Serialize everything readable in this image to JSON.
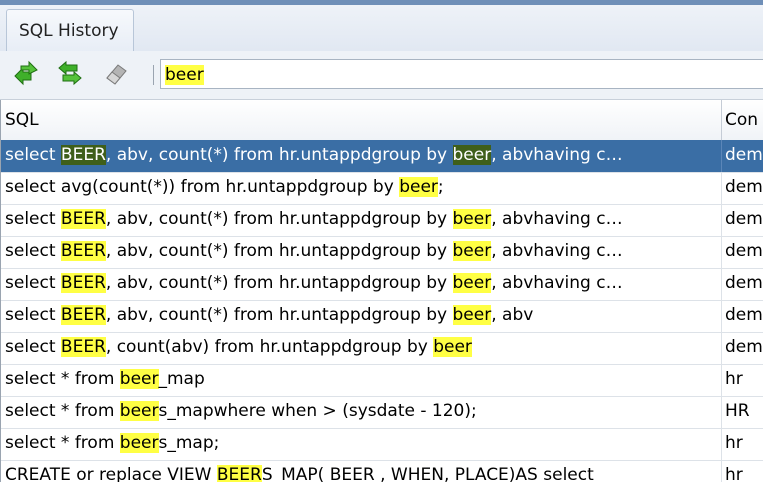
{
  "panel": {
    "title": "SQL History"
  },
  "colors": {
    "highlight": "#ffff44",
    "selected_row": "#3a6ea5",
    "selected_match": "#3f5f1a"
  },
  "toolbar": {
    "buttons": [
      {
        "icon": "append-green-arrows-icon"
      },
      {
        "icon": "replace-green-arrows-icon"
      },
      {
        "icon": "eraser-icon"
      }
    ],
    "filter_value": "beer"
  },
  "table": {
    "headers": {
      "sql": "SQL",
      "connection": "Con"
    },
    "rows": [
      {
        "selected": true,
        "conn": "dem",
        "parts": [
          [
            "select ",
            false
          ],
          [
            "BEER",
            true
          ],
          [
            ", abv, count(*) from hr.untappdgroup by ",
            false
          ],
          [
            "beer",
            true
          ],
          [
            ", abvhaving c…",
            false
          ]
        ]
      },
      {
        "selected": false,
        "conn": "dem",
        "parts": [
          [
            "select avg(count(*)) from hr.untappdgroup by ",
            false
          ],
          [
            "beer",
            true
          ],
          [
            ";",
            false
          ]
        ]
      },
      {
        "selected": false,
        "conn": "dem",
        "parts": [
          [
            "select ",
            false
          ],
          [
            "BEER",
            true
          ],
          [
            ", abv, count(*) from hr.untappdgroup by ",
            false
          ],
          [
            "beer",
            true
          ],
          [
            ", abvhaving c…",
            false
          ]
        ]
      },
      {
        "selected": false,
        "conn": "dem",
        "parts": [
          [
            "select ",
            false
          ],
          [
            "BEER",
            true
          ],
          [
            ", abv, count(*) from hr.untappdgroup by ",
            false
          ],
          [
            "beer",
            true
          ],
          [
            ", abvhaving c…",
            false
          ]
        ]
      },
      {
        "selected": false,
        "conn": "dem",
        "parts": [
          [
            "select ",
            false
          ],
          [
            "BEER",
            true
          ],
          [
            ", abv, count(*) from hr.untappdgroup by ",
            false
          ],
          [
            "beer",
            true
          ],
          [
            ", abvhaving c…",
            false
          ]
        ]
      },
      {
        "selected": false,
        "conn": "dem",
        "parts": [
          [
            "select ",
            false
          ],
          [
            "BEER",
            true
          ],
          [
            ", abv, count(*) from hr.untappdgroup by ",
            false
          ],
          [
            "beer",
            true
          ],
          [
            ", abv",
            false
          ]
        ]
      },
      {
        "selected": false,
        "conn": "dem",
        "parts": [
          [
            "select ",
            false
          ],
          [
            "BEER",
            true
          ],
          [
            ", count(abv) from hr.untappdgroup by ",
            false
          ],
          [
            "beer",
            true
          ]
        ]
      },
      {
        "selected": false,
        "conn": "hr",
        "parts": [
          [
            "select * from ",
            false
          ],
          [
            "beer",
            true
          ],
          [
            "_map",
            false
          ]
        ]
      },
      {
        "selected": false,
        "conn": "HR",
        "parts": [
          [
            "select * from ",
            false
          ],
          [
            "beer",
            true
          ],
          [
            "s_mapwhere when > (sysdate - 120);",
            false
          ]
        ]
      },
      {
        "selected": false,
        "conn": "hr",
        "parts": [
          [
            "select * from ",
            false
          ],
          [
            "beer",
            true
          ],
          [
            "s_map;",
            false
          ]
        ]
      },
      {
        "selected": false,
        "conn": "hr",
        "parts": [
          [
            "CREATE or replace VIEW ",
            false
          ],
          [
            "BEER",
            true
          ],
          [
            "S_MAP( BEER , WHEN, PLACE)AS select",
            false
          ]
        ]
      }
    ]
  }
}
